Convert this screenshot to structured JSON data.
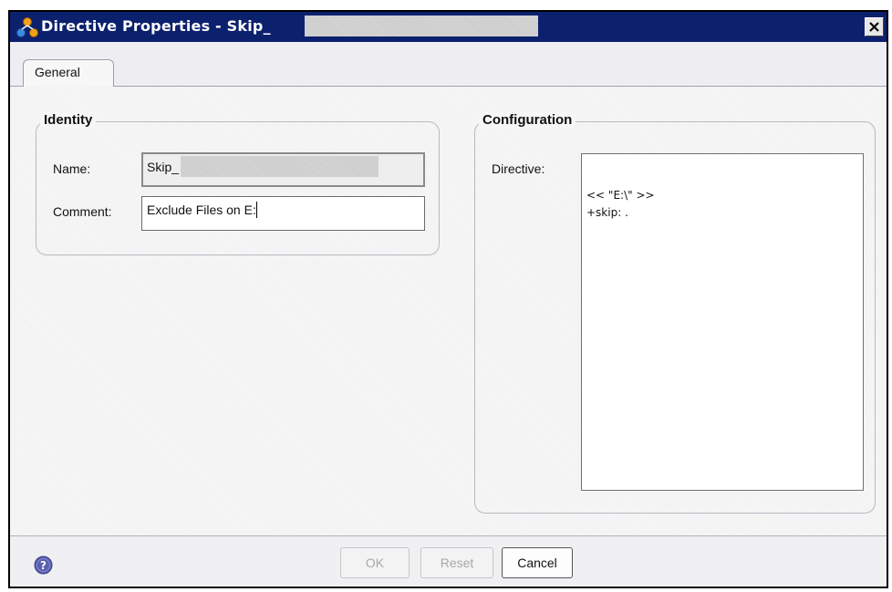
{
  "window": {
    "title": "Directive Properties - Skip_",
    "close_label": "✕"
  },
  "tabs": [
    {
      "label": "General",
      "selected": true
    }
  ],
  "identity": {
    "group_label": "Identity",
    "name_label": "Name:",
    "name_value": "Skip_",
    "comment_label": "Comment:",
    "comment_value": "Exclude Files on E:"
  },
  "configuration": {
    "group_label": "Configuration",
    "directive_label": "Directive:",
    "directive_lines": [
      "<< \"E:\\\" >>",
      "+skip: ."
    ]
  },
  "buttons": {
    "ok": "OK",
    "reset": "Reset",
    "cancel": "Cancel"
  },
  "icons": {
    "app": "directive-app-icon",
    "help": "help-icon",
    "close": "close-icon"
  },
  "colors": {
    "titlebar": "#0c216e",
    "help_icon": "#5b5fb0"
  }
}
